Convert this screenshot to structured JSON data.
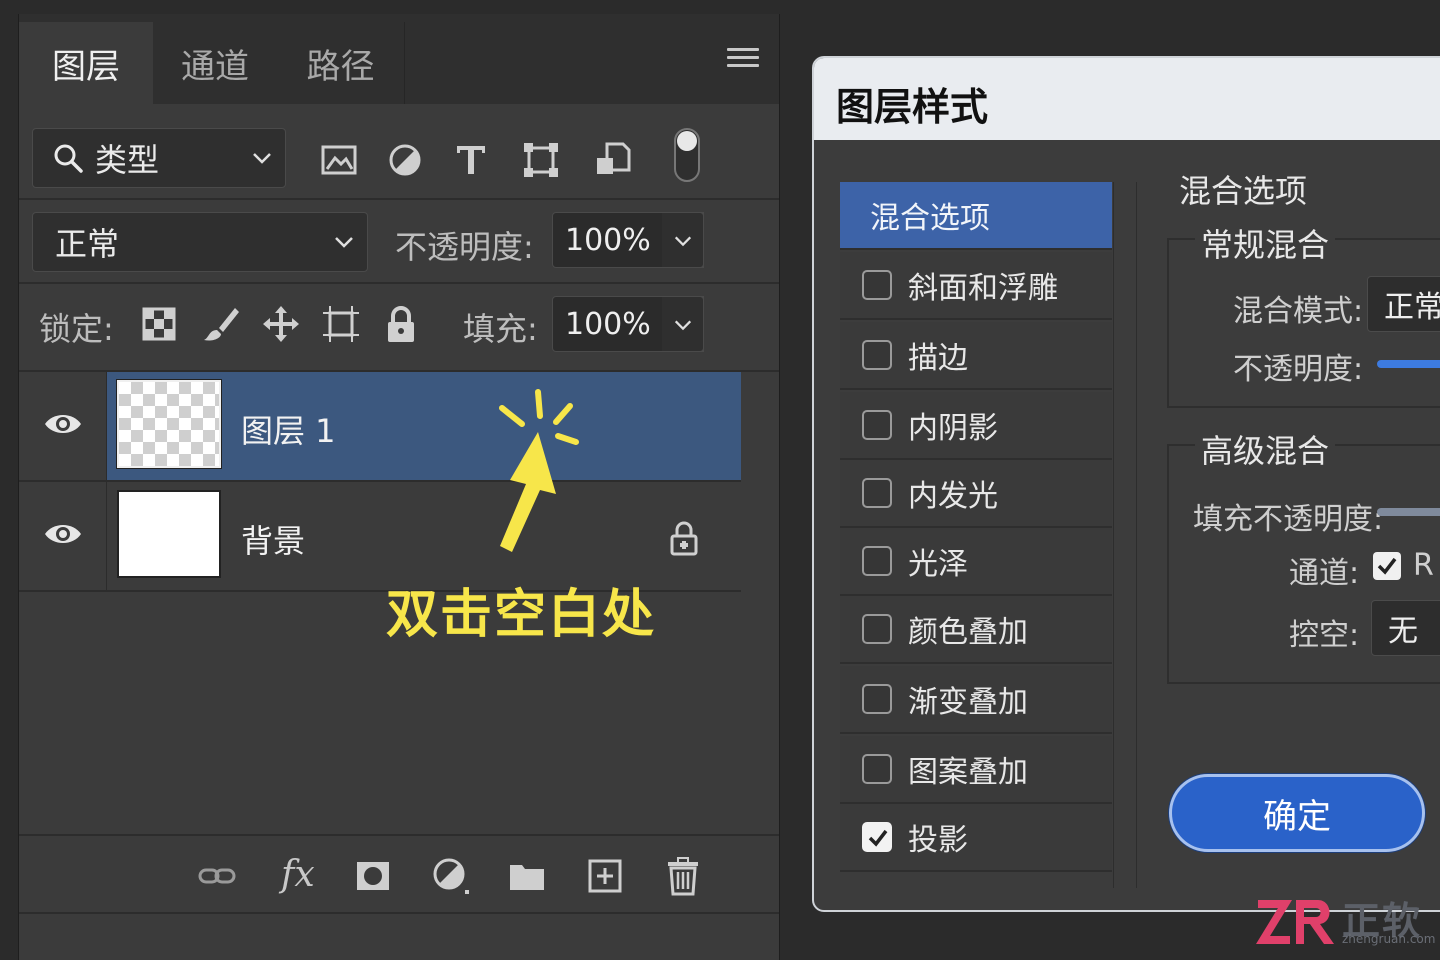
{
  "layers_panel": {
    "tabs": [
      {
        "label": "图层",
        "active": true
      },
      {
        "label": "通道",
        "active": false
      },
      {
        "label": "路径",
        "active": false
      }
    ],
    "filter": {
      "label": "类型"
    },
    "blend_mode": "正常",
    "opacity": {
      "label": "不透明度:",
      "value": "100%"
    },
    "lock": {
      "label": "锁定:"
    },
    "fill": {
      "label": "填充:",
      "value": "100%"
    },
    "layers": [
      {
        "name": "图层 1",
        "selected": true,
        "visible": true,
        "locked": false
      },
      {
        "name": "背景",
        "selected": false,
        "visible": true,
        "locked": true
      }
    ]
  },
  "annotation": {
    "text": "双击空白处",
    "color": "#f7e64a"
  },
  "dialog": {
    "title": "图层样式",
    "styles": [
      {
        "label": "混合选项",
        "active": true,
        "has_checkbox": false
      },
      {
        "label": "斜面和浮雕",
        "checked": false,
        "has_checkbox": true
      },
      {
        "label": "描边",
        "checked": false,
        "has_checkbox": true
      },
      {
        "label": "内阴影",
        "checked": false,
        "has_checkbox": true
      },
      {
        "label": "内发光",
        "checked": false,
        "has_checkbox": true
      },
      {
        "label": "光泽",
        "checked": false,
        "has_checkbox": true
      },
      {
        "label": "颜色叠加",
        "checked": false,
        "has_checkbox": true
      },
      {
        "label": "渐变叠加",
        "checked": false,
        "has_checkbox": true
      },
      {
        "label": "图案叠加",
        "checked": false,
        "has_checkbox": true
      },
      {
        "label": "投影",
        "checked": true,
        "has_checkbox": true
      }
    ],
    "blend_options": {
      "title": "混合选项",
      "general": {
        "title": "常规混合",
        "mode_label": "混合模式:",
        "mode_value": "正常",
        "opacity_label": "不透明度:"
      },
      "advanced": {
        "title": "高级混合",
        "fill_opacity_label": "填充不透明度:",
        "channels_label": "通道:",
        "channel_r": "R",
        "knockout_label": "控空:",
        "knockout_value": "无"
      }
    },
    "ok_button": "确定"
  },
  "logo": {
    "text": "正软",
    "url": "zhengruan.com",
    "mark": "ZR"
  },
  "colors": {
    "accent": "#3d63a8",
    "selection": "#3c587f",
    "button": "#2a62c9"
  }
}
